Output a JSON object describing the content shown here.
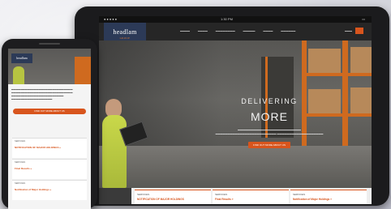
{
  "tablet": {
    "status_time": "1:30 PM",
    "logo": "headlam",
    "logo_sub": "GROUP",
    "hero_line1": "DELIVERING",
    "hero_line2": "MORE",
    "cta": "FIND OUT MORE ABOUT US",
    "cards": [
      {
        "kicker": "SERVICES",
        "title": "NOTIFICATION OF MAJOR HOLDINGS"
      },
      {
        "kicker": "SERVICES",
        "title": "Final Results »"
      },
      {
        "kicker": "SERVICES",
        "title": "Notification of Major Holdings »"
      }
    ]
  },
  "phone": {
    "logo": "headlam",
    "cta": "FIND OUT MORE ABOUT US",
    "cards": [
      {
        "kicker": "SERVICES",
        "title": "NOTIFICATION OF MAJOR HOLDINGS »"
      },
      {
        "kicker": "SERVICES",
        "title": "Final Results »"
      },
      {
        "kicker": "SERVICES",
        "title": "Notification of Major Holdings »"
      }
    ]
  },
  "colors": {
    "accent": "#d8551d",
    "logo_bg": "#2c3a57",
    "rack": "#cf6a1f"
  }
}
